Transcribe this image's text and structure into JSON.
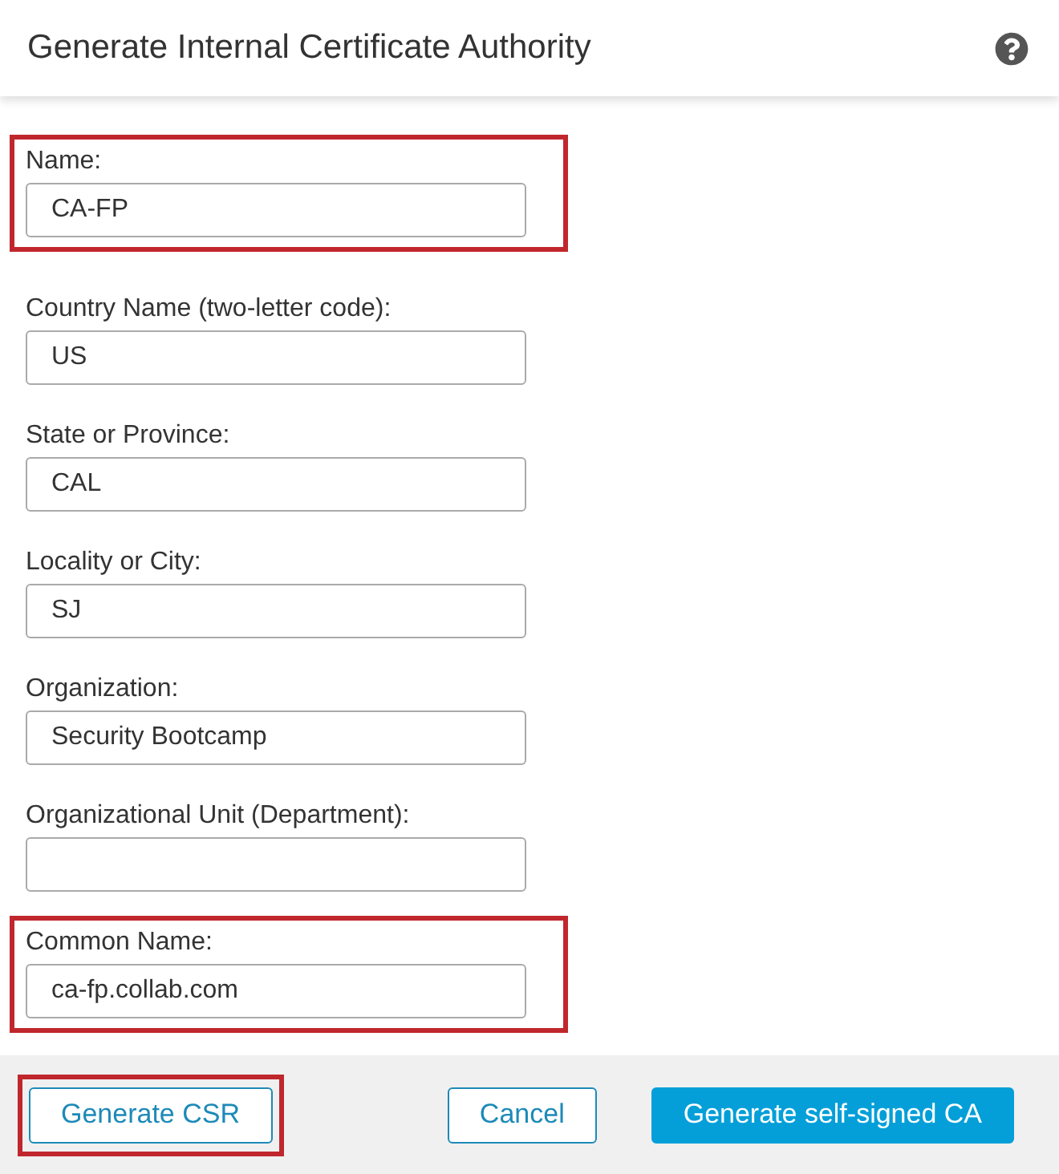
{
  "dialog": {
    "title": "Generate Internal Certificate Authority"
  },
  "fields": [
    {
      "label": "Name:",
      "value": "CA-FP",
      "highlighted": true
    },
    {
      "label": "Country Name (two-letter code):",
      "value": "US",
      "highlighted": false
    },
    {
      "label": "State or Province:",
      "value": "CAL",
      "highlighted": false
    },
    {
      "label": "Locality or City:",
      "value": "SJ",
      "highlighted": false
    },
    {
      "label": "Organization:",
      "value": "Security Bootcamp",
      "highlighted": false
    },
    {
      "label": "Organizational Unit (Department):",
      "highlighted": false
    },
    {
      "label": "Common Name:",
      "value": "ca-fp.collab.com",
      "highlighted": true
    }
  ],
  "buttons": [
    {
      "label": "Generate CSR",
      "kind": "secondary",
      "highlighted": true
    },
    {
      "label": "Cancel",
      "kind": "secondary",
      "highlighted": false
    },
    {
      "label": "Generate self-signed CA",
      "kind": "primary",
      "highlighted": false
    }
  ]
}
